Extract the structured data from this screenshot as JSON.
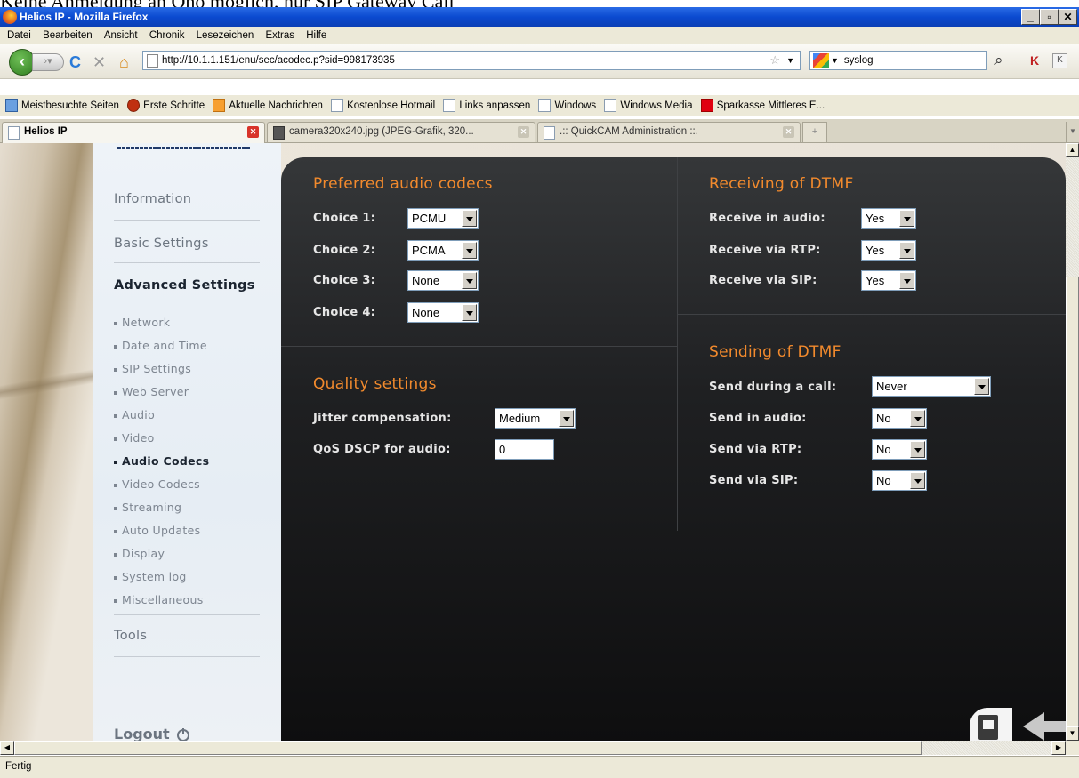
{
  "page_caption": "Keine Anmeldung an Oho möglich, nur SIP Gateway Call",
  "window": {
    "title": "Helios IP - Mozilla Firefox"
  },
  "menu": [
    "Datei",
    "Bearbeiten",
    "Ansicht",
    "Chronik",
    "Lesezeichen",
    "Extras",
    "Hilfe"
  ],
  "toolbar": {
    "url": "http://10.1.1.151/enu/sec/acodec.p?sid=998173935",
    "search_value": "syslog"
  },
  "bookmarks": [
    "Meistbesuchte Seiten",
    "Erste Schritte",
    "Aktuelle Nachrichten",
    "Kostenlose Hotmail",
    "Links anpassen",
    "Windows",
    "Windows Media",
    "Sparkasse Mittleres E..."
  ],
  "tabs": [
    "Helios IP",
    "camera320x240.jpg (JPEG-Grafik, 320...",
    ".:: QuickCAM Administration ::."
  ],
  "sidebar": {
    "main": [
      "Information",
      "Basic Settings",
      "Advanced Settings",
      "Tools"
    ],
    "sub": [
      "Network",
      "Date and Time",
      "SIP Settings",
      "Web Server",
      "Audio",
      "Video",
      "Audio Codecs",
      "Video Codecs",
      "Streaming",
      "Auto Updates",
      "Display",
      "System log",
      "Miscellaneous"
    ],
    "logout": "Logout"
  },
  "codecs": {
    "title": "Preferred audio codecs",
    "choices": [
      {
        "label": "Choice 1:",
        "value": "PCMU"
      },
      {
        "label": "Choice 2:",
        "value": "PCMA"
      },
      {
        "label": "Choice 3:",
        "value": "None"
      },
      {
        "label": "Choice 4:",
        "value": "None"
      }
    ]
  },
  "quality": {
    "title": "Quality settings",
    "jitter_label": "Jitter compensation:",
    "jitter_value": "Medium",
    "qos_label": "QoS DSCP for audio:",
    "qos_value": "0"
  },
  "receiving": {
    "title": "Receiving of DTMF",
    "rows": [
      {
        "label": "Receive in audio:",
        "value": "Yes"
      },
      {
        "label": "Receive via RTP:",
        "value": "Yes"
      },
      {
        "label": "Receive via SIP:",
        "value": "Yes"
      }
    ]
  },
  "sending": {
    "title": "Sending of DTMF",
    "rows": [
      {
        "label": "Send during a call:",
        "value": "Never"
      },
      {
        "label": "Send in audio:",
        "value": "No"
      },
      {
        "label": "Send via RTP:",
        "value": "No"
      },
      {
        "label": "Send via SIP:",
        "value": "No"
      }
    ]
  },
  "status": "Fertig",
  "colors": {
    "accent_orange": "#f28a2d",
    "panel_dark": "#1f2022",
    "titlebar_blue": "#0b4ad0"
  }
}
